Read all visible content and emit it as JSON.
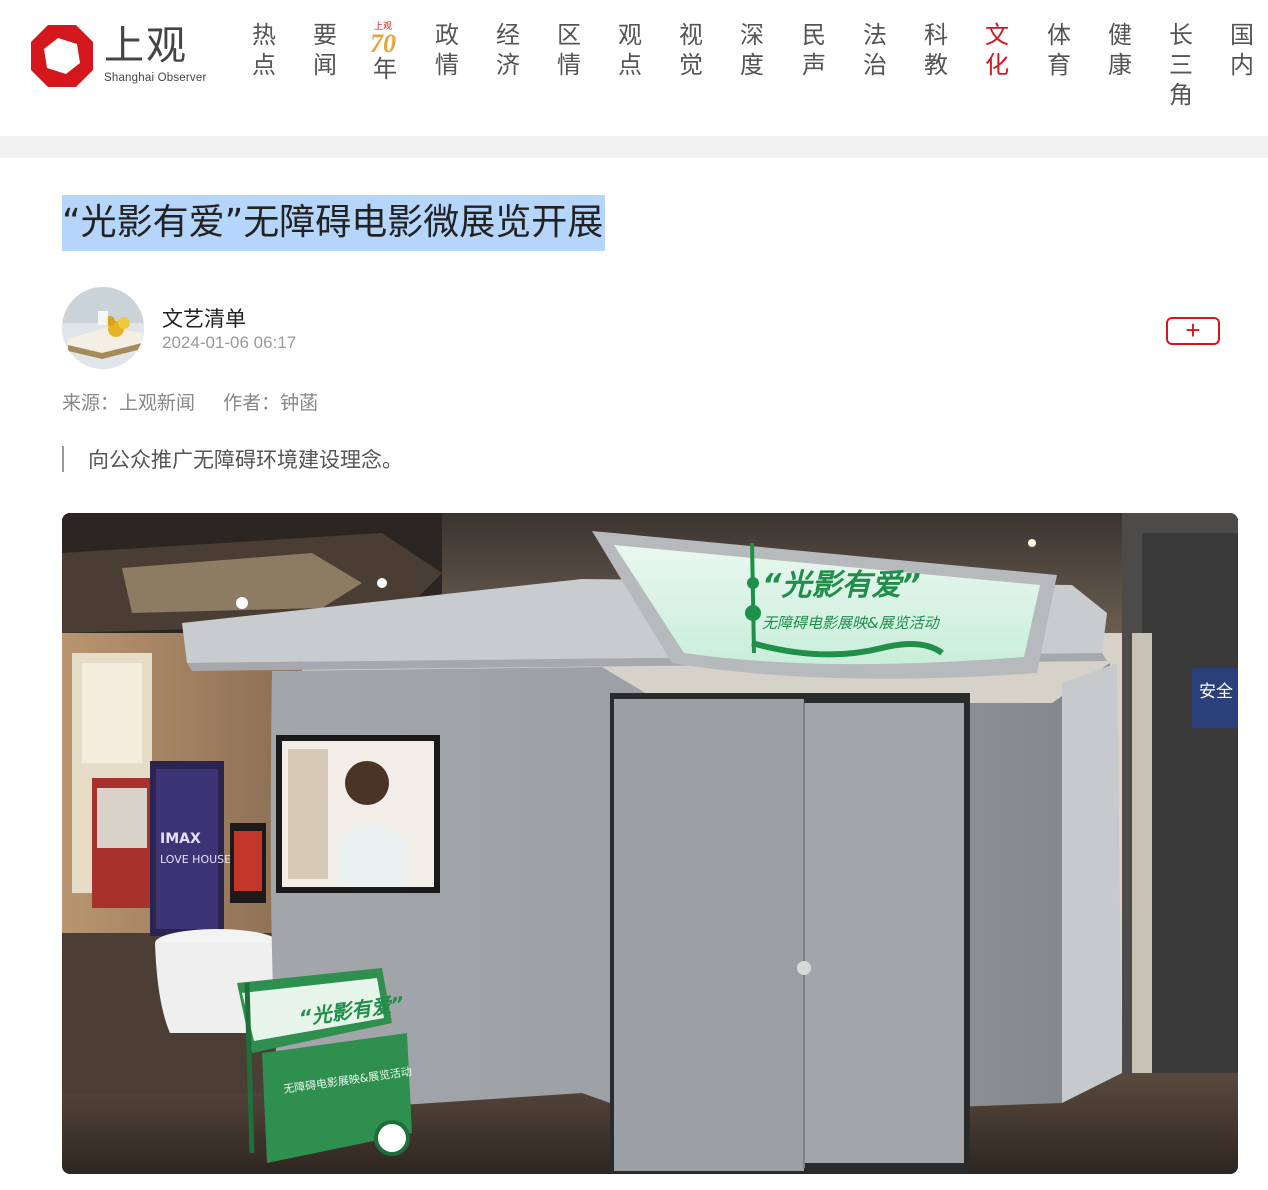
{
  "site": {
    "logo_cn": "上观",
    "logo_en": "Shanghai Observer"
  },
  "nav": {
    "items": [
      {
        "label": "热点"
      },
      {
        "label": "要闻"
      },
      {
        "label": "上观",
        "special": "70年"
      },
      {
        "label": "政情"
      },
      {
        "label": "经济"
      },
      {
        "label": "区情"
      },
      {
        "label": "观点"
      },
      {
        "label": "视觉"
      },
      {
        "label": "深度"
      },
      {
        "label": "民声"
      },
      {
        "label": "法治"
      },
      {
        "label": "科教"
      },
      {
        "label": "文化",
        "active": true
      },
      {
        "label": "体育"
      },
      {
        "label": "健康"
      },
      {
        "label": "长三角"
      },
      {
        "label": "国内"
      }
    ],
    "special_small": "上观",
    "special_num": "70",
    "special_year": "年"
  },
  "article": {
    "title": "“光影有爱”无障碍电影微展览开展",
    "author": "文艺清单",
    "date": "2024-01-06 06:17",
    "follow_icon": "plus-icon",
    "source": "来源：上观新闻",
    "writer": "作者：钟菡",
    "summary": "向公众推广无障碍环境建设理念。",
    "photo": {
      "banner_title": "“光影有爱”",
      "banner_subtitle": "无障碍电影展映&展览活动",
      "standee_title": "“光影有爱”",
      "standee_subtitle": "无障碍电影展映&展览活动",
      "wall_sign": "安全",
      "poster_text": "IMAX LOVE HOUSE"
    }
  },
  "colors": {
    "brand_red": "#d4161d",
    "title_highlight": "#b5d5fb",
    "booth_gray": "#9ea3a8",
    "banner_green": "#3fae6a"
  }
}
